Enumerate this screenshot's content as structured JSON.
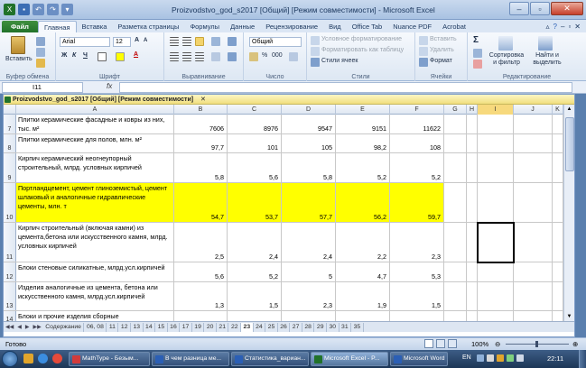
{
  "window": {
    "title": "Proizvodstvo_god_s2017  [Общий]  [Режим совместимости] - Microsoft Excel"
  },
  "ribbon_tabs": [
    "Файл",
    "Главная",
    "Вставка",
    "Разметка страницы",
    "Формулы",
    "Данные",
    "Рецензирование",
    "Вид",
    "Office Tab",
    "Nuance PDF",
    "Acrobat"
  ],
  "active_tab": "Главная",
  "ribbon": {
    "clipboard": {
      "paste": "Вставить",
      "label": "Буфер обмена"
    },
    "font": {
      "name": "Arial",
      "size": "12",
      "label": "Шрифт"
    },
    "alignment": {
      "label": "Выравнивание"
    },
    "number": {
      "format": "Общий",
      "percent": "%",
      "thousands": "000",
      "label": "Число"
    },
    "styles": {
      "conditional": "Условное форматирование",
      "table": "Форматировать как таблицу",
      "cell_styles": "Стили ячеек",
      "label": "Стили"
    },
    "cells": {
      "insert": "Вставить",
      "delete": "Удалить",
      "format": "Формат",
      "label": "Ячейки"
    },
    "editing": {
      "sum": "Σ",
      "sort": "Сортировка и фильтр",
      "find": "Найти и выделить",
      "label": "Редактирование"
    }
  },
  "formula_bar": {
    "name_box": "I11",
    "fx": "fx",
    "value": ""
  },
  "workbook": {
    "title": "Proizvodstvo_god_s2017  [Общий]  [Режим совместимости]",
    "columns": [
      "A",
      "B",
      "C",
      "D",
      "E",
      "F",
      "G",
      "H",
      "I",
      "J",
      "K"
    ],
    "selected_column": "I",
    "rows": [
      {
        "num": "7",
        "label": "Плитки керамические фасадные и ковры из них,  тыс. м²",
        "values": [
          "7606",
          "8976",
          "9547",
          "9151",
          "11622"
        ],
        "highlight": false
      },
      {
        "num": "8",
        "label": "Плитки керамические для полов,  млн. м²",
        "values": [
          "97,7",
          "101",
          "105",
          "98,2",
          "108"
        ],
        "highlight": false
      },
      {
        "num": "9",
        "label": "Кирпич керамический неогнеупорный строительный, млрд. условных кирпичей",
        "values": [
          "5,8",
          "5,6",
          "5,8",
          "5,2",
          "5,2"
        ],
        "highlight": false
      },
      {
        "num": "10",
        "label": "Портландцемент, цемент глиноземистый, цемент шлаковый и аналогичные гидравлические цементы, млн. т",
        "values": [
          "54,7",
          "53,7",
          "57,7",
          "56,2",
          "59,7"
        ],
        "highlight": true
      },
      {
        "num": "11",
        "label": "Кирпич строительный (включая камни) из цемента,бетона или искусственного камня, млрд. условных кирпичей",
        "values": [
          "2,5",
          "2,4",
          "2,4",
          "2,2",
          "2,3"
        ],
        "highlight": false
      },
      {
        "num": "12",
        "label": "Блоки стеновые силикатные, млрд.усл.кирпичей",
        "values": [
          "5,6",
          "5,2",
          "5",
          "4,7",
          "5,3"
        ],
        "highlight": false
      },
      {
        "num": "13",
        "label": "Изделия аналогичные из цемента, бетона или искусственного камня, млрд.усл.кирпичей",
        "values": [
          "1,3",
          "1,5",
          "2,3",
          "1,9",
          "1,5"
        ],
        "highlight": false
      },
      {
        "num": "14",
        "label": "Блоки и прочие изделия сборные",
        "values": [
          "",
          "",
          "",
          "",
          ""
        ],
        "highlight": false
      }
    ],
    "sheet_tabs": [
      "Содержание",
      "06, 08",
      "11",
      "12",
      "13",
      "14",
      "15",
      "16",
      "17",
      "19",
      "20",
      "21",
      "22",
      "23",
      "24",
      "25",
      "26",
      "27",
      "28",
      "29",
      "30",
      "31",
      "35"
    ],
    "active_sheet": "23"
  },
  "status_bar": {
    "ready": "Готово",
    "zoom": "100%"
  },
  "taskbar": {
    "items": [
      "MathType - Безым...",
      "В чем разница ме...",
      "Статистика_вариан...",
      "Microsoft Excel - P...",
      "Microsoft Word"
    ],
    "active_index": 3,
    "lang": "EN",
    "time": "22:11"
  },
  "colors": {
    "highlight": "#ffff00",
    "file_tab": "#21722a",
    "selection": "#000000"
  }
}
